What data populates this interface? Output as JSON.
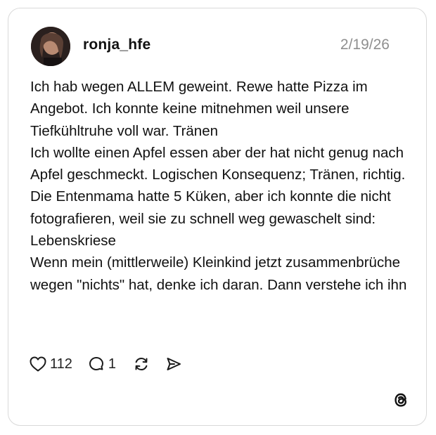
{
  "post": {
    "username": "ronja_hfe",
    "date": "2/19/26",
    "text": "Ich hab wegen ALLEM geweint. Rewe hatte Pizza im Angebot. Ich konnte keine mitnehmen weil unsere Tiefkühltruhe voll war. Tränen\nIch wollte einen Apfel essen aber der hat nicht genug nach Apfel geschmeckt. Logischen Konsequenz; Tränen, richtig.\nDie Entenmama hatte 5 Küken, aber ich konnte die nicht fotografieren, weil sie zu schnell weg gewaschelt sind: Lebenskriese\nWenn mein (mittlerweile) Kleinkind jetzt zusammenbrüche wegen \"nichts\" hat, denke ich daran. Dann verstehe ich ihn"
  },
  "actions": {
    "likes": "112",
    "comments": "1"
  },
  "icons": {
    "like": "heart-icon",
    "comment": "comment-bubble-icon",
    "repost": "repost-icon",
    "share": "send-icon",
    "brand": "threads-logo-icon"
  }
}
